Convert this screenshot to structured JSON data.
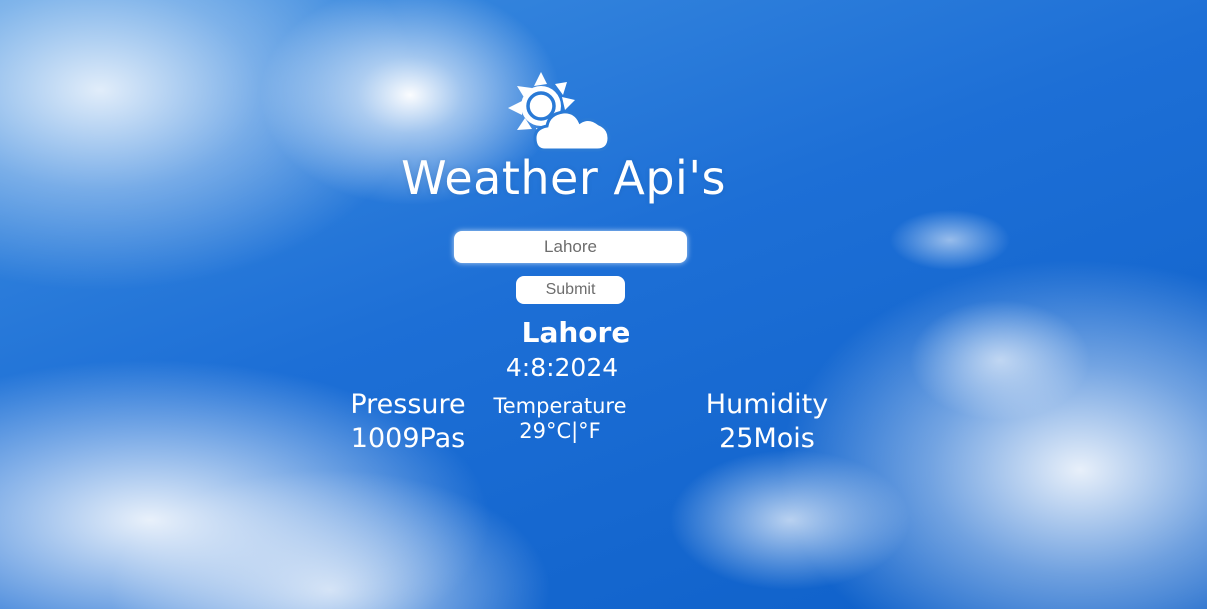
{
  "app": {
    "title": "Weather Api's",
    "logo_icon": "sun-behind-cloud-icon"
  },
  "search": {
    "value": "Lahore",
    "submit_label": "Submit"
  },
  "result": {
    "city": "Lahore",
    "date": "4:8:2024",
    "pressure": {
      "label": "Pressure",
      "value": "1009Pas"
    },
    "temperature": {
      "label": "Temperature",
      "value": "29°C|°F"
    },
    "humidity": {
      "label": "Humidity",
      "value": "25Mois"
    }
  },
  "colors": {
    "sky": "#1d6fd6",
    "text": "#ffffff",
    "input_text": "#6d6d6d"
  }
}
